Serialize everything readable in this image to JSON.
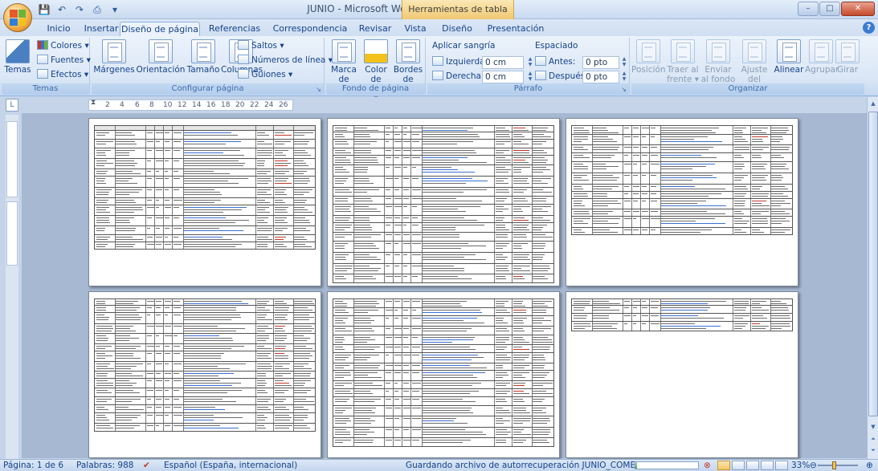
{
  "window": {
    "title": "JUNIO - Microsoft Word",
    "contextual_tab": "Herramientas de tabla",
    "controls": [
      "–",
      "□",
      "✕"
    ]
  },
  "qat": {
    "save": "💾",
    "undo": "↶",
    "redo": "↷",
    "print": "⎙",
    "dropdown": "▾"
  },
  "tabs": [
    "Inicio",
    "Insertar",
    "Diseño de página",
    "Referencias",
    "Correspondencia",
    "Revisar",
    "Vista",
    "Diseño",
    "Presentación"
  ],
  "help": "?",
  "ribbon": {
    "temas": {
      "label": "Temas",
      "temas_btn": "Temas",
      "colores": "Colores ▾",
      "fuentes": "Fuentes ▾",
      "efectos": "Efectos ▾",
      "launcher": ""
    },
    "config": {
      "label": "Configurar página",
      "margenes": "Márgenes",
      "orientacion": "Orientación",
      "tamano": "Tamaño",
      "columnas": "Columnas",
      "saltos": "Saltos ▾",
      "numeros": "Números de línea ▾",
      "guiones": "Guiones ▾",
      "launcher": "↘"
    },
    "fondo": {
      "label": "Fondo de página",
      "marca": "Marca de agua ▾",
      "color": "Color de página ▾",
      "bordes": "Bordes de página"
    },
    "parrafo": {
      "label": "Párrafo",
      "sangria": "Aplicar sangría",
      "izquierda_label": "Izquierda:",
      "izquierda_val": "0 cm",
      "derecha_label": "Derecha:",
      "derecha_val": "0 cm",
      "espaciado": "Espaciado",
      "antes_label": "Antes:",
      "antes_val": "0 pto",
      "despues_label": "Después:",
      "despues_val": "0 pto",
      "launcher": "↘"
    },
    "organizar": {
      "label": "Organizar",
      "posicion": "Posición",
      "traer": "Traer al frente ▾",
      "enviar": "Enviar al fondo ▾",
      "ajuste": "Ajuste del texto ▾",
      "alinear": "Alinear",
      "agrupar": "Agrupar",
      "girar": "Girar"
    }
  },
  "ruler": {
    "ticks": [
      "2",
      "4",
      "6",
      "8",
      "10",
      "12",
      "14",
      "16",
      "18",
      "20",
      "22",
      "24",
      "26"
    ],
    "corner": "L"
  },
  "statusbar": {
    "page": "Página: 1 de 6",
    "words": "Palabras: 988",
    "language": "Español (España, internacional)",
    "autosave": "Guardando archivo de autorrecuperación  JUNIO_COMENTARIOS:",
    "zoom": "33%"
  },
  "colors": {
    "ribbon_bg": "#dbe7f6",
    "doc_bg": "#a6b8d2",
    "link": "#3b6fd4",
    "accent_red": "#c0392b"
  }
}
